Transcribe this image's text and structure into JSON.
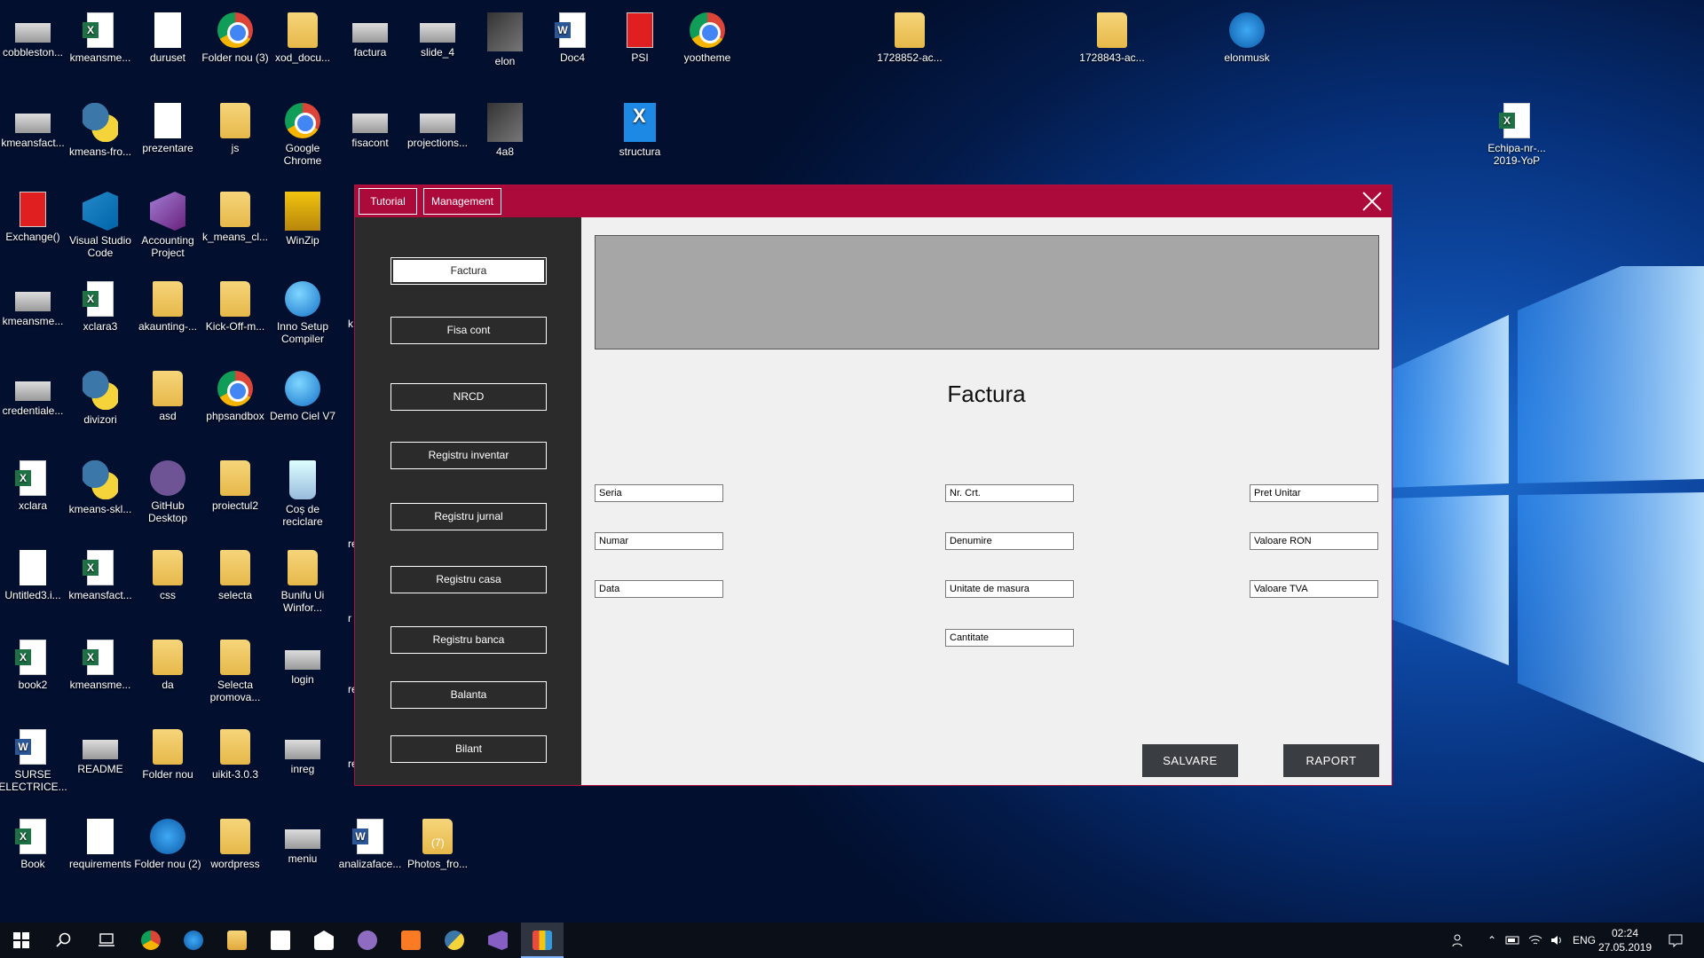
{
  "desktop": {
    "icons": [
      {
        "label": "cobbleston...",
        "type": "img"
      },
      {
        "label": "kmeansme...",
        "type": "xl"
      },
      {
        "label": "duruset",
        "type": "txt"
      },
      {
        "label": "Folder nou (3)",
        "type": "chrome"
      },
      {
        "label": "xod_docu...",
        "type": "folder"
      },
      {
        "label": "factura",
        "type": "img"
      },
      {
        "label": "slide_4",
        "type": "img"
      },
      {
        "label": "elon",
        "type": "photo"
      },
      {
        "label": "Doc4",
        "type": "word"
      },
      {
        "label": "PSI",
        "type": "pdf"
      },
      {
        "label": "yootheme",
        "type": "chrome"
      },
      {
        "label": "1728852-ac...",
        "type": "folder"
      },
      {
        "label": "1728843-ac...",
        "type": "folder"
      },
      {
        "label": "elonmusk",
        "type": "dev"
      },
      {
        "label": "kmeansfact...",
        "type": "img"
      },
      {
        "label": "kmeans-fro...",
        "type": "py"
      },
      {
        "label": "prezentare",
        "type": "txt"
      },
      {
        "label": "js",
        "type": "folder"
      },
      {
        "label": "Google Chrome",
        "type": "chrome"
      },
      {
        "label": "fisacont",
        "type": "img"
      },
      {
        "label": "projections...",
        "type": "img"
      },
      {
        "label": "4a8",
        "type": "photo"
      },
      {
        "label": "structura",
        "type": "struct"
      },
      {
        "label": "Echipa-nr-... 2019-YoP",
        "type": "xl"
      },
      {
        "label": "Exchange()",
        "type": "pdf"
      },
      {
        "label": "Visual Studio Code",
        "type": "vs"
      },
      {
        "label": "Accounting Project",
        "type": "vsp"
      },
      {
        "label": "k_means_cl...",
        "type": "folder"
      },
      {
        "label": "WinZip",
        "type": "zip"
      },
      {
        "label": "kmeansme...",
        "type": "img"
      },
      {
        "label": "xclara3",
        "type": "xl"
      },
      {
        "label": "akaunting-...",
        "type": "folder"
      },
      {
        "label": "Kick-Off-m...",
        "type": "folder"
      },
      {
        "label": "Inno Setup Compiler",
        "type": "globe"
      },
      {
        "label": "credentiale...",
        "type": "img"
      },
      {
        "label": "divizori",
        "type": "py"
      },
      {
        "label": "asd",
        "type": "folder"
      },
      {
        "label": "phpsandbox",
        "type": "chrome"
      },
      {
        "label": "Demo Ciel V7",
        "type": "globe"
      },
      {
        "label": "xclara",
        "type": "xl"
      },
      {
        "label": "kmeans-skl...",
        "type": "py"
      },
      {
        "label": "GitHub Desktop",
        "type": "github"
      },
      {
        "label": "proiectul2",
        "type": "folder"
      },
      {
        "label": "Coș de reciclare",
        "type": "bin"
      },
      {
        "label": "Untitled3.i...",
        "type": "txt"
      },
      {
        "label": "kmeansfact...",
        "type": "xl"
      },
      {
        "label": "css",
        "type": "folder"
      },
      {
        "label": "selecta",
        "type": "folder"
      },
      {
        "label": "Bunifu Ui Winfor...",
        "type": "folder"
      },
      {
        "label": "book2",
        "type": "xl"
      },
      {
        "label": "kmeansme...",
        "type": "xl"
      },
      {
        "label": "da",
        "type": "folder"
      },
      {
        "label": "Selecta promova...",
        "type": "folder"
      },
      {
        "label": "login",
        "type": "img"
      },
      {
        "label": "SURSE ELECTRICE...",
        "type": "word"
      },
      {
        "label": "README",
        "type": "img"
      },
      {
        "label": "Folder nou",
        "type": "folder"
      },
      {
        "label": "uikit-3.0.3",
        "type": "folder"
      },
      {
        "label": "inreg",
        "type": "img"
      },
      {
        "label": "Book",
        "type": "xl"
      },
      {
        "label": "requirements",
        "type": "txt"
      },
      {
        "label": "Folder nou (2)",
        "type": "dev"
      },
      {
        "label": "wordpress",
        "type": "folder"
      },
      {
        "label": "meniu",
        "type": "img"
      },
      {
        "label": "analizaface...",
        "type": "word"
      },
      {
        "label": "Photos_fro...",
        "type": "folder"
      }
    ],
    "partial_labels": [
      "k",
      "re",
      "r",
      "reg",
      "re",
      "(7)"
    ]
  },
  "app": {
    "tabs": [
      "Tutorial",
      "Management"
    ],
    "sidebar": [
      "Factura",
      "Fisa cont",
      "NRCD",
      "Registru inventar",
      "Registru jurnal",
      "Registru casa",
      "Registru banca",
      "Balanta",
      "Bilant"
    ],
    "active_sidebar": "Factura",
    "form_title": "Factura",
    "fields": {
      "seria": "Seria",
      "numar": "Numar",
      "data": "Data",
      "nr_crt": "Nr. Crt.",
      "denumire": "Denumire",
      "unitate": "Unitate de masura",
      "cantitate": "Cantitate",
      "pret_unitar": "Pret Unitar",
      "valoare_ron": "Valoare RON",
      "valoare_tva": "Valoare TVA"
    },
    "buttons": {
      "salvare": "SALVARE",
      "raport": "RAPORT"
    },
    "colors": {
      "titlebar": "#ad0a3c",
      "sidebar": "#2b2b2b",
      "button": "#3a3e43"
    }
  },
  "taskbar": {
    "apps": [
      "start-icon",
      "search-icon",
      "task-view-icon",
      "chrome-icon",
      "edge-dev-icon",
      "file-explorer-icon",
      "store-icon",
      "mail-icon",
      "github-icon",
      "xampp-icon",
      "python-icon",
      "visual-studio-icon",
      "winforms-app-icon"
    ],
    "language": "ENG",
    "time": "02:24",
    "date": "27.05.2019"
  }
}
